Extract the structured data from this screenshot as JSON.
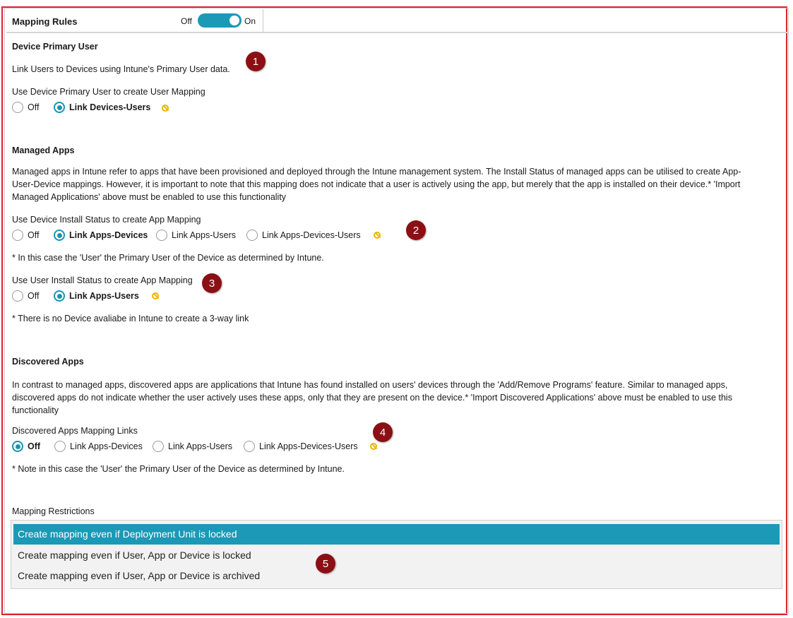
{
  "header": {
    "title": "Mapping Rules",
    "toggle_off_label": "Off",
    "toggle_on_label": "On",
    "toggle_state": "On"
  },
  "sections": {
    "device_primary_user": {
      "title": "Device Primary User",
      "description": "Link Users to Devices using Intune's Primary User data.",
      "option_label": "Use Device Primary User to create User Mapping",
      "options": [
        "Off",
        "Link Devices-Users"
      ],
      "selected": "Link Devices-Users"
    },
    "managed_apps": {
      "title": "Managed Apps",
      "description_lines": [
        "Managed apps in Intune refer to apps that have been provisioned and deployed through the Intune management system. The Install Status of managed apps can be utilised to create App-",
        "User-Device mappings. However, it is important to note that this mapping does not indicate that a user is actively using the app, but merely that the app is installed on their device.* 'Import",
        "Managed Applications' above must be enabled to use this functionality"
      ],
      "device_install": {
        "label": "Use Device Install Status to create App Mapping",
        "options": [
          "Off",
          "Link Apps-Devices",
          "Link Apps-Users",
          "Link Apps-Devices-Users"
        ],
        "selected": "Link Apps-Devices",
        "note": "* In this case the 'User' the Primary User of the Device as determined by Intune."
      },
      "user_install": {
        "label": "Use User Install Status to create App Mapping",
        "options": [
          "Off",
          "Link Apps-Users"
        ],
        "selected": "Link Apps-Users",
        "note": "* There is no Device avaliabe in Intune to create a 3-way link"
      }
    },
    "discovered_apps": {
      "title": "Discovered Apps",
      "description_lines": [
        "In contrast to managed apps, discovered apps are applications that Intune has found installed on users' devices through the 'Add/Remove Programs' feature. Similar to managed apps,",
        "discovered apps do not indicate whether the user actively uses these apps, only that they are present on the device.* 'Import Discovered Applications' above must be enabled to use this",
        "functionality"
      ],
      "links": {
        "label": "Discovered Apps Mapping Links",
        "options": [
          "Off",
          "Link Apps-Devices",
          "Link Apps-Users",
          "Link Apps-Devices-Users"
        ],
        "selected": "Off",
        "note": "* Note in this case the 'User' the Primary User of the Device as determined by Intune."
      }
    },
    "mapping_restrictions": {
      "label": "Mapping Restrictions",
      "items": [
        "Create mapping even if Deployment Unit is locked",
        "Create mapping even if User, App or Device is locked",
        "Create mapping even if User, App or Device is archived"
      ],
      "selected_index": 0
    }
  },
  "callouts": [
    "1",
    "2",
    "3",
    "4",
    "5"
  ],
  "colors": {
    "accent": "#1b99b6",
    "callout": "#8b0f14",
    "warning_icon": "#f0b400",
    "annotation_border": "#d9262c"
  }
}
